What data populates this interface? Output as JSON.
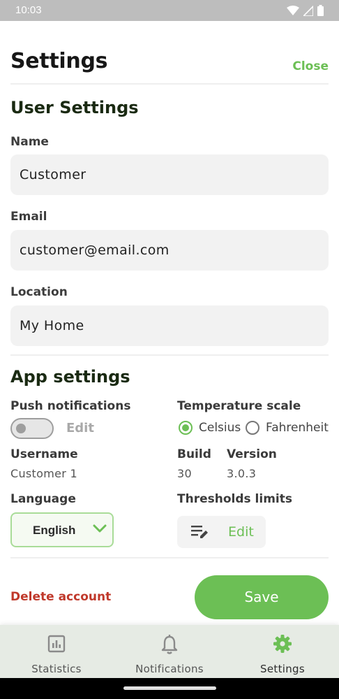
{
  "status_bar": {
    "time": "10:03"
  },
  "header": {
    "title": "Settings",
    "close_label": "Close"
  },
  "user_settings": {
    "heading": "User Settings",
    "name": {
      "label": "Name",
      "value": "Customer"
    },
    "email": {
      "label": "Email",
      "value": "customer@email.com"
    },
    "location": {
      "label": "Location",
      "value": "My Home"
    }
  },
  "app_settings": {
    "heading": "App settings",
    "push_notifications": {
      "label": "Push notifications",
      "enabled": false,
      "edit_label": "Edit"
    },
    "temperature_scale": {
      "label": "Temperature scale",
      "options": [
        "Celsius",
        "Fahrenheit"
      ],
      "selected": "Celsius"
    },
    "username": {
      "label": "Username",
      "value": "Customer 1"
    },
    "build": {
      "label": "Build",
      "value": "30"
    },
    "version": {
      "label": "Version",
      "value": "3.0.3"
    },
    "language": {
      "label": "Language",
      "value": "English"
    },
    "thresholds": {
      "label": "Thresholds limits",
      "edit_label": "Edit"
    }
  },
  "actions": {
    "delete_label": "Delete account",
    "save_label": "Save"
  },
  "bottom_nav": {
    "items": [
      {
        "label": "Statistics",
        "icon": "bar-chart-icon"
      },
      {
        "label": "Notifications",
        "icon": "bell-icon"
      },
      {
        "label": "Settings",
        "icon": "gear-icon",
        "active": true
      }
    ]
  },
  "colors": {
    "accent": "#6cbf55",
    "danger": "#c0392b",
    "field_bg": "#f2f2f2",
    "nav_bg": "#e6ebe4"
  }
}
